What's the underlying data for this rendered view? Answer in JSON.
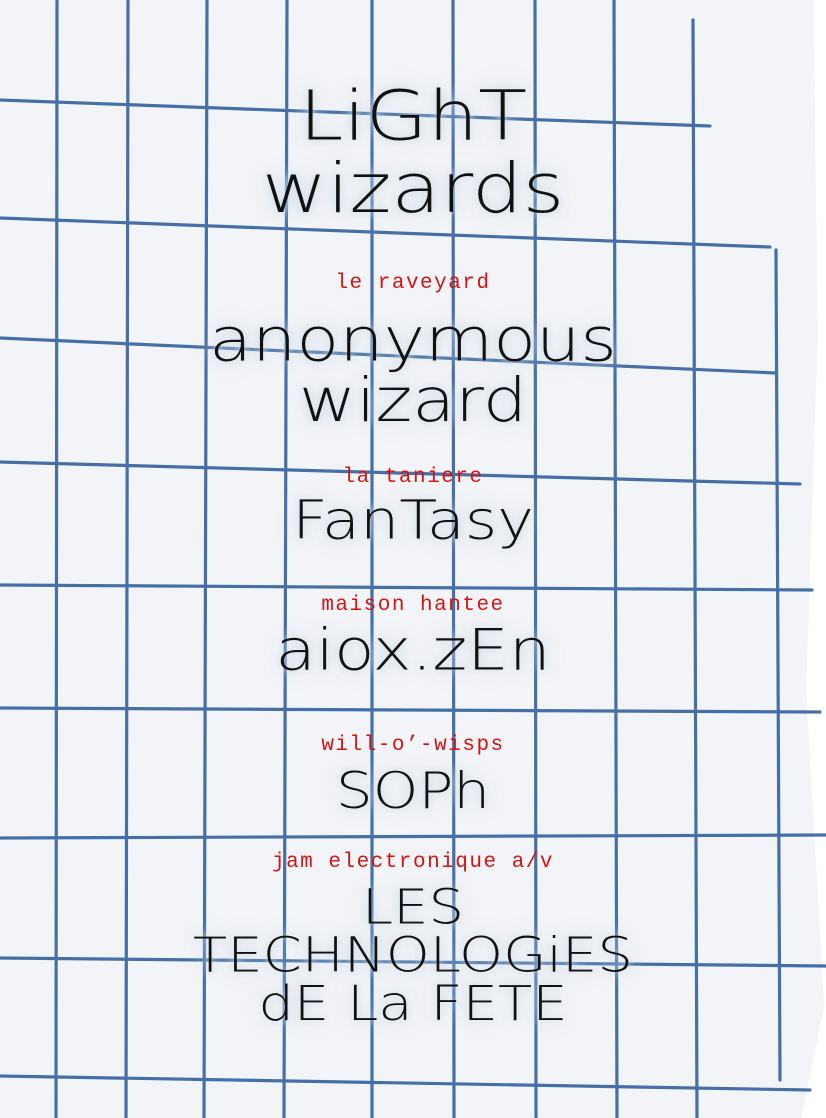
{
  "headliner": {
    "line1": "LiGhT",
    "line2": "wizards"
  },
  "acts": [
    {
      "venue": "le raveyard",
      "line1": "anonymous",
      "line2": "wizard"
    },
    {
      "venue": "la taniere",
      "line1": "FanTasy"
    },
    {
      "venue": "maison hantee",
      "line1": "aiox.zEn"
    },
    {
      "venue": "will-o’-wisps",
      "line1": "SOPh"
    },
    {
      "venue": "jam electronique a/v",
      "line1": "LES",
      "line2": "TECHNOLOGiES",
      "line3": "dE La FETE"
    }
  ],
  "colors": {
    "paper": "#f3f4f7",
    "grid_line": "#2f5d9b",
    "venue_text": "#d21414",
    "hand_text": "#111111"
  }
}
